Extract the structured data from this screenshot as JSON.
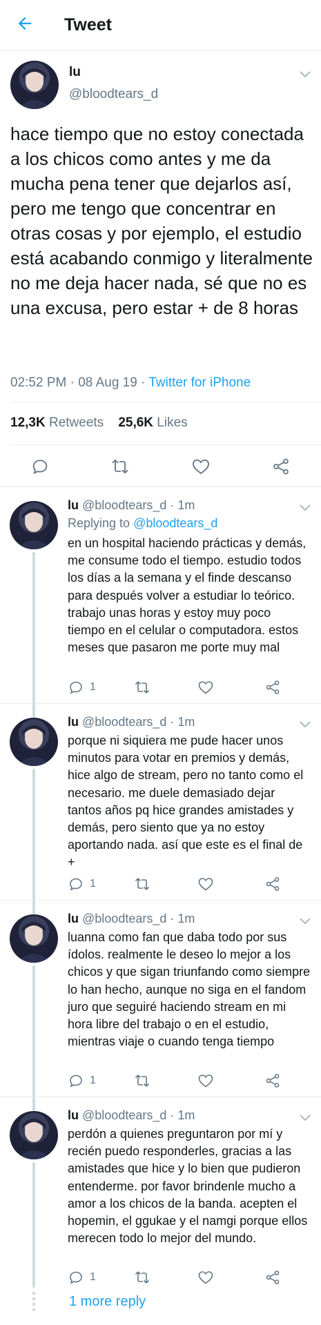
{
  "header": {
    "title": "Tweet"
  },
  "tweet": {
    "name": "lu",
    "handle": "@bloodtears_d",
    "text": "hace tiempo que no estoy conectada a los chicos como antes y me da mucha pena tener que dejarlos así, pero me tengo que concentrar en otras cosas y por ejemplo, el estudio está acabando conmigo y literalmente no me deja hacer nada, sé que no es una excusa, pero estar + de 8 horas",
    "time": "02:52 PM · 08 Aug 19 · ",
    "source": "Twitter for iPhone",
    "retweets": "12,3K",
    "retweets_label": " Retweets",
    "likes": "25,6K",
    "likes_label": " Likes"
  },
  "replies": [
    {
      "name": "lu",
      "handle": "@bloodtears_d · 1m",
      "replying_label": "Replying to ",
      "replying_to": "@bloodtears_d",
      "text": "en un hospital haciendo prácticas y demás, me consume todo el tiempo. estudio todos los días a la semana y el finde descanso para después volver a estudiar lo teórico. trabajo unas horas y estoy muy poco tiempo en el celular o computadora. estos meses que pasaron me porte muy mal",
      "reply_count": "1"
    },
    {
      "name": "lu",
      "handle": "@bloodtears_d · 1m",
      "text": "porque ni siquiera me pude hacer unos minutos para votar en premios y demás, hice algo de stream, pero no tanto como el necesario. me duele demasiado dejar tantos años pq hice grandes amistades y demás, pero siento que ya no estoy aportando nada. así que este es el final de +",
      "reply_count": "1"
    },
    {
      "name": "lu",
      "handle": "@bloodtears_d · 1m",
      "text": "luanna como fan que daba todo por sus ídolos. realmente le deseo lo mejor a los chicos y que sigan triunfando como siempre lo han hecho, aunque no siga en el fandom juro que seguiré haciendo stream en mi hora libre del trabajo o en el estudio, mientras viaje o cuando tenga tiempo",
      "reply_count": "1"
    },
    {
      "name": "lu",
      "handle": "@bloodtears_d · 1m",
      "text": "perdón a quienes preguntaron por mí y recién puedo responderles, gracias a las amistades que hice y lo bien que pudieron entenderme. por favor brindenle mucho a amor a los chicos de la banda. acepten el hopemin, el ggukae y el namgi porque ellos merecen todo lo mejor del mundo.",
      "reply_count": "1"
    }
  ],
  "more_replies": "1 more reply",
  "colors": {
    "accent": "#1da1f2",
    "secondary": "#657786",
    "text": "#14171a",
    "border": "#e6ecf0"
  },
  "icons": [
    "back-arrow-icon",
    "chevron-down-icon",
    "reply-icon",
    "retweet-icon",
    "like-icon",
    "share-icon"
  ]
}
